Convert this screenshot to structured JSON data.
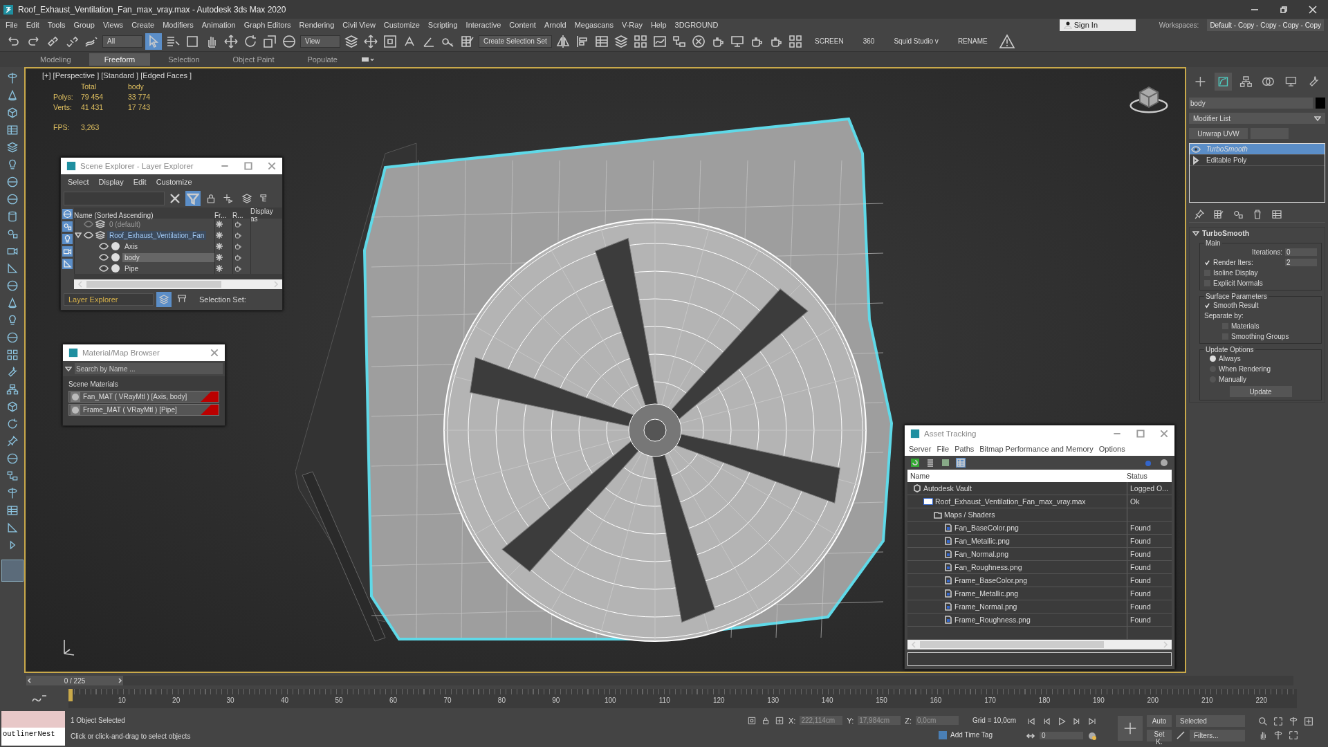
{
  "window": {
    "title": "Roof_Exhaust_Ventilation_Fan_max_vray.max - Autodesk 3ds Max 2020"
  },
  "menu": [
    "File",
    "Edit",
    "Tools",
    "Group",
    "Views",
    "Create",
    "Modifiers",
    "Animation",
    "Graph Editors",
    "Rendering",
    "Civil View",
    "Customize",
    "Scripting",
    "Interactive",
    "Content",
    "Arnold",
    "Megascans",
    "V-Ray",
    "Help",
    "3DGROUND"
  ],
  "account": {
    "sign_in": "Sign In",
    "workspaces_label": "Workspaces:",
    "workspace": "Default - Copy - Copy - Copy - Copy"
  },
  "toolbar": {
    "selection_filter": "All",
    "view_dropdown": "View",
    "selection_set": "Create Selection Set",
    "extras": [
      "SCREEN",
      "360",
      "Squid Studio v",
      "RENAME"
    ]
  },
  "ribbon_tabs": [
    {
      "label": "Modeling",
      "selected": false
    },
    {
      "label": "Freeform",
      "selected": true
    },
    {
      "label": "Selection",
      "selected": false
    },
    {
      "label": "Object Paint",
      "selected": false
    },
    {
      "label": "Populate",
      "selected": false
    }
  ],
  "viewport": {
    "label": "[+] [Perspective ] [Standard ] [Edged Faces ]",
    "stats_headers": [
      "Total",
      "body"
    ],
    "stats": [
      {
        "label": "Polys:",
        "total": "79 454",
        "selected": "33 774"
      },
      {
        "label": "Verts:",
        "total": "41 431",
        "selected": "17 743"
      }
    ],
    "fps_label": "FPS:",
    "fps": "3,263"
  },
  "scene_explorer": {
    "title": "Scene Explorer - Layer Explorer",
    "menu": [
      "Select",
      "Display",
      "Edit",
      "Customize"
    ],
    "columns": [
      "Name (Sorted Ascending)",
      "Fr...",
      "R...",
      "Display as"
    ],
    "rows": [
      {
        "name": "0 (default)",
        "kind": "layer",
        "selected": false,
        "hidden": true
      },
      {
        "name": "Roof_Exhaust_Ventilation_Fan",
        "kind": "layer",
        "selected": false,
        "hidden": false,
        "expanded": true,
        "children": [
          {
            "name": "Axis",
            "kind": "object",
            "selected": false,
            "hidden": false
          },
          {
            "name": "body",
            "kind": "object",
            "selected": true,
            "hidden": false
          },
          {
            "name": "Pipe",
            "kind": "object",
            "selected": false,
            "hidden": false
          }
        ]
      }
    ],
    "explorer_mode": "Layer Explorer",
    "selection_set_label": "Selection Set:"
  },
  "material_browser": {
    "title": "Material/Map Browser",
    "search": {
      "placeholder": "Search by Name ..."
    },
    "group": "Scene Materials",
    "materials": [
      "Fan_MAT  ( VRayMtl )  [Axis, body]",
      "Frame_MAT  ( VRayMtl )  [Pipe]"
    ]
  },
  "asset_tracking": {
    "title": "Asset Tracking",
    "menu": [
      "Server",
      "File",
      "Paths",
      "Bitmap Performance and Memory",
      "Options"
    ],
    "columns": [
      "Name",
      "Status"
    ],
    "rows": [
      {
        "name": "Autodesk Vault",
        "kind": "vault",
        "status": "Logged O...",
        "children": [
          {
            "name": "Roof_Exhaust_Ventilation_Fan_max_vray.max",
            "kind": "scene",
            "status": "Ok",
            "children": [
              {
                "name": "Maps / Shaders",
                "kind": "folder",
                "children": [
                  {
                    "name": "Fan_BaseColor.png",
                    "kind": "file",
                    "status": "Found"
                  },
                  {
                    "name": "Fan_Metallic.png",
                    "kind": "file",
                    "status": "Found"
                  },
                  {
                    "name": "Fan_Normal.png",
                    "kind": "file",
                    "status": "Found"
                  },
                  {
                    "name": "Fan_Roughness.png",
                    "kind": "file",
                    "status": "Found"
                  },
                  {
                    "name": "Frame_BaseColor.png",
                    "kind": "file",
                    "status": "Found"
                  },
                  {
                    "name": "Frame_Metallic.png",
                    "kind": "file",
                    "status": "Found"
                  },
                  {
                    "name": "Frame_Normal.png",
                    "kind": "file",
                    "status": "Found"
                  },
                  {
                    "name": "Frame_Roughness.png",
                    "kind": "file",
                    "status": "Found"
                  }
                ]
              }
            ]
          }
        ]
      }
    ]
  },
  "command_panel": {
    "object_name": "body",
    "modifier_list": "Modifier List",
    "modifier_button": "Unwrap UVW",
    "stack": [
      {
        "label": "TurboSmooth",
        "selected": true
      },
      {
        "label": "Editable Poly",
        "selected": false
      }
    ],
    "rollout": {
      "title": "TurboSmooth",
      "main_group": "Main",
      "iterations_label": "Iterations:",
      "iterations": "0",
      "render_iters_label": "Render Iters:",
      "render_iters_checked": true,
      "render_iters": "2",
      "checks_main": [
        {
          "label": "Isoline Display",
          "checked": false
        },
        {
          "label": "Explicit Normals",
          "checked": false
        }
      ],
      "surface_group": "Surface Parameters",
      "smooth_result": {
        "label": "Smooth Result",
        "checked": true
      },
      "separate_label": "Separate by:",
      "separate": [
        {
          "label": "Materials",
          "checked": false
        },
        {
          "label": "Smoothing Groups",
          "checked": false
        }
      ],
      "update_group": "Update Options",
      "update_modes": [
        {
          "label": "Always",
          "selected": true
        },
        {
          "label": "When Rendering",
          "selected": false
        },
        {
          "label": "Manually",
          "selected": false
        }
      ],
      "update_button": "Update"
    }
  },
  "timeline": {
    "frame": "0 / 225",
    "level": 0,
    "ticks": [
      "10",
      "20",
      "30",
      "40",
      "50",
      "60",
      "70",
      "80",
      "90",
      "100",
      "110",
      "120",
      "130",
      "140",
      "150",
      "160",
      "170",
      "180",
      "190",
      "200",
      "210",
      "220"
    ]
  },
  "status_bar": {
    "listener": "outlinerNest",
    "selection": "1 Object Selected",
    "prompt": "Click or click-and-drag to select objects",
    "coords": [
      {
        "label": "X:",
        "value": "222,114cm"
      },
      {
        "label": "Y:",
        "value": "17,984cm"
      },
      {
        "label": "Z:",
        "value": "0,0cm"
      }
    ],
    "grid": "Grid = 10,0cm",
    "time_tag": "Add Time Tag",
    "frame": "0",
    "key_mode": "Auto",
    "key_filter": "Selected",
    "set_key": "Set K.",
    "filters": "Filters..."
  }
}
